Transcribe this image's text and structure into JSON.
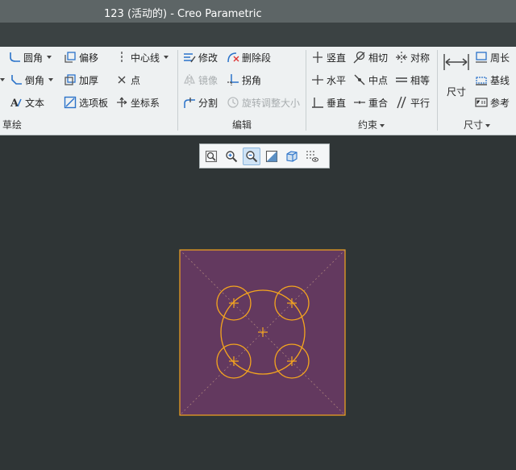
{
  "window": {
    "title": "123 (活动的) - Creo Parametric"
  },
  "ribbon": {
    "sketch_group": {
      "label": "草绘",
      "tools": [
        {
          "label": "圆角",
          "icon": "fillet-icon"
        },
        {
          "label": "偏移",
          "icon": "offset-icon"
        },
        {
          "label": "中心线",
          "icon": "centerline-icon"
        },
        {
          "label": "倒角",
          "icon": "chamfer-icon"
        },
        {
          "label": "加厚",
          "icon": "thicken-icon"
        },
        {
          "label": "点",
          "icon": "point-icon"
        },
        {
          "label": "文本",
          "icon": "text-icon"
        },
        {
          "label": "选项板",
          "icon": "palette-icon"
        },
        {
          "label": "坐标系",
          "icon": "coordinate-system-icon"
        }
      ]
    },
    "edit_group": {
      "label": "编辑",
      "tools": [
        {
          "label": "修改",
          "icon": "modify-icon"
        },
        {
          "label": "删除段",
          "icon": "delete-segment-icon"
        },
        {
          "label": "镜像",
          "icon": "mirror-icon"
        },
        {
          "label": "拐角",
          "icon": "corner-icon"
        },
        {
          "label": "分割",
          "icon": "divide-icon"
        },
        {
          "label": "旋转调整大小",
          "icon": "rotate-resize-icon"
        }
      ]
    },
    "constrain_group": {
      "label": "约束",
      "tools": [
        {
          "label": "竖直",
          "icon": "vertical-icon"
        },
        {
          "label": "相切",
          "icon": "tangent-icon"
        },
        {
          "label": "对称",
          "icon": "symmetric-icon"
        },
        {
          "label": "水平",
          "icon": "horizontal-icon"
        },
        {
          "label": "中点",
          "icon": "midpoint-icon"
        },
        {
          "label": "相等",
          "icon": "equal-icon"
        },
        {
          "label": "垂直",
          "icon": "perpendicular-icon"
        },
        {
          "label": "重合",
          "icon": "coincident-icon"
        },
        {
          "label": "平行",
          "icon": "parallel-icon"
        }
      ]
    },
    "dimension_group": {
      "label": "尺寸",
      "main_tool": {
        "label": "尺寸",
        "icon": "dimension-icon"
      },
      "tools": [
        {
          "label": "周长",
          "icon": "perimeter-icon"
        },
        {
          "label": "基线",
          "icon": "baseline-icon"
        },
        {
          "label": "参考",
          "icon": "reference-icon"
        }
      ]
    }
  },
  "view_toolbar": {
    "buttons": [
      {
        "icon": "refit-icon"
      },
      {
        "icon": "zoom-in-icon"
      },
      {
        "icon": "zoom-out-icon",
        "active": true
      },
      {
        "icon": "display-style-icon"
      },
      {
        "icon": "saved-orientations-icon"
      },
      {
        "icon": "sketch-display-filter-icon"
      }
    ]
  },
  "sketch": {
    "colors": {
      "background": "#2f3536",
      "region_fill": "#63395f",
      "geometry": "#f5a51e",
      "guides": "#a77f7a"
    }
  }
}
